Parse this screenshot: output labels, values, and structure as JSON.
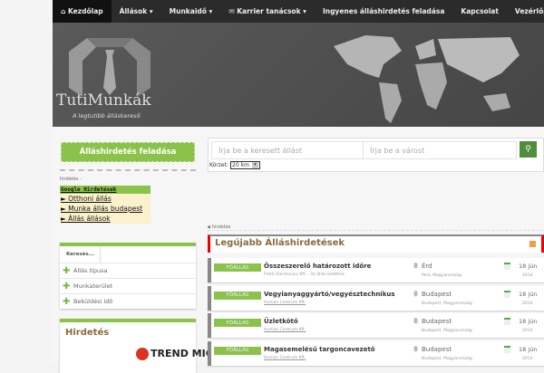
{
  "nav": {
    "items": [
      {
        "label": "Kezdőlap",
        "icon": "home-icon"
      },
      {
        "label": "Állások ▾"
      },
      {
        "label": "Munkaidő ▾"
      },
      {
        "label": "Karrier tanácsok ▾",
        "icon": "briefcase-icon"
      },
      {
        "label": "Ingyenes álláshirdetés feladása"
      },
      {
        "label": "Kapcsolat"
      },
      {
        "label": "Vezérlőpult ▾"
      }
    ]
  },
  "header": {
    "brand": "TutiMunkák",
    "tagline": "A legtutibb álláskereső"
  },
  "sidebar": {
    "post_button": "Álláshirdetés feladása",
    "ad_label": "hirdetés -",
    "google": {
      "title": "Google Hirdetések",
      "links": [
        "► Otthoni állás",
        "► Munka állás budapest",
        "► Állás állások"
      ]
    },
    "search_box": {
      "tab": "Keresés...",
      "rows": [
        "Állás típusa",
        "Munkaterület",
        "Beküldési idő"
      ]
    },
    "ads_title": "Hirdetés",
    "ad_brand": "TREND MICRO"
  },
  "search": {
    "keyword_placeholder": "Írja be a keresett állást",
    "city_placeholder": "Írja be a várost",
    "radius_label": "Körzet:",
    "radius_value": "20 km"
  },
  "main": {
    "ad_label": "▪ hirdetés",
    "section_title": "Legújabb Álláshirdetések",
    "jobs": [
      {
        "badge": "FŐÁLLÁS",
        "title": "Összeszerelő határozott időre",
        "company": "Pretti Electronics Kft. - Az állás betöltve",
        "city": "Érd",
        "region": "Pest, Magyarország",
        "day": "18 jún",
        "year": "2014"
      },
      {
        "badge": "FŐÁLLÁS",
        "title": "Vegyianyaggyártó/vegyésztechnikus",
        "company": "Human Centrum Kft.",
        "city": "Budapest",
        "region": "Budapest, Magyarország",
        "day": "18 jún",
        "year": "2014"
      },
      {
        "badge": "FŐÁLLÁS",
        "title": "Üzletkötő",
        "company": "Human Centrum Kft.",
        "city": "Budapest",
        "region": "Budapest, Magyarország",
        "day": "18 jún",
        "year": "2014"
      },
      {
        "badge": "FŐÁLLÁS",
        "title": "Magasemelésű targoncavezető",
        "company": "Human Centrum Kft.",
        "city": "Budapest",
        "region": "Budapest, Magyarország",
        "day": "18 jún",
        "year": "2014"
      }
    ]
  }
}
